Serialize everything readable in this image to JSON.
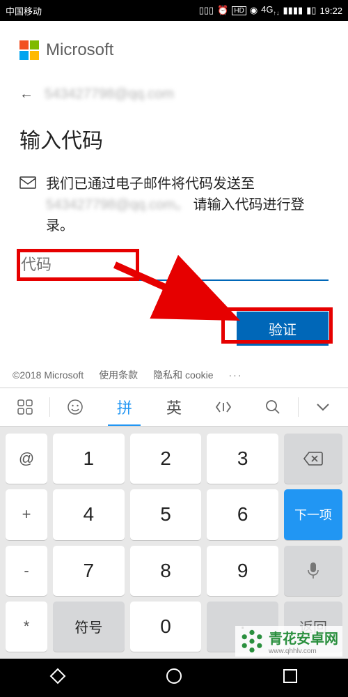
{
  "statusbar": {
    "carrier": "中国移动",
    "network": "4G",
    "time": "19:22"
  },
  "header": {
    "brand": "Microsoft",
    "account_masked": "543427798@qq.com"
  },
  "page": {
    "title": "输入代码",
    "message_prefix": "我们已通过电子邮件将代码发送至",
    "masked_email": "543427798@qq.com。",
    "message_suffix": "请输入代码进行登录。",
    "code_placeholder": "代码",
    "verify_label": "验证"
  },
  "footer": {
    "copyright": "©2018 Microsoft",
    "terms": "使用条款",
    "privacy": "隐私和 cookie",
    "more": "···"
  },
  "ime": {
    "apps": "⌗",
    "emoji": "☺",
    "pinyin": "拼",
    "english": "英",
    "code": "‹Þ›",
    "search": "⌕",
    "collapse": "⌄"
  },
  "keypad": {
    "r1": [
      "@",
      "1",
      "2",
      "3",
      "⌫"
    ],
    "r2": [
      "+",
      "4",
      "5",
      "6",
      "下一项"
    ],
    "r3": [
      "-",
      "7",
      "8",
      "9",
      "mic"
    ],
    "r4": [
      "*",
      "符号",
      "0",
      "·",
      "返回"
    ]
  },
  "watermark": {
    "name": "青花安卓网",
    "url": "www.qhhlv.com"
  }
}
